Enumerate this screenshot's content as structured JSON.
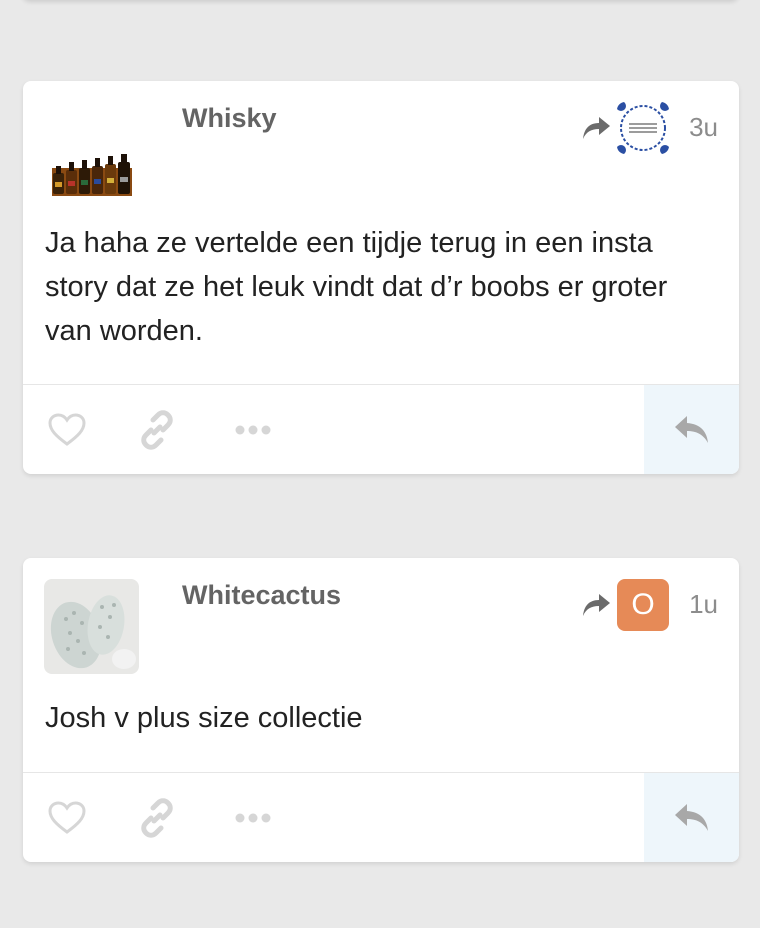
{
  "posts": [
    {
      "username": "Whisky",
      "time": "3u",
      "avatar_icon": "whisky-bottles-avatar",
      "reply_to_avatar_icon": "delft-tile-avatar",
      "content": "Ja haha ze vertelde een tijdje terug in een insta story dat ze het leuk vindt dat d’r boobs er groter van worden."
    },
    {
      "username": "Whitecactus",
      "time": "1u",
      "avatar_icon": "white-cactus-avatar",
      "reply_to_letter": "O",
      "content": "Josh v plus size collectie"
    }
  ],
  "colors": {
    "page_background": "#e9e9e9",
    "card_background": "#ffffff",
    "username": "#646464",
    "timestamp": "#8c8c8c",
    "footer_icons": "#d6d6d6",
    "reply_button_bg": "#eef6fb",
    "letter_avatar_bg": "#e68a57"
  },
  "icons": {
    "like": "heart-icon",
    "link": "link-icon",
    "more": "ellipsis-icon",
    "reply": "reply-icon",
    "reply_to": "share-arrow-icon"
  }
}
